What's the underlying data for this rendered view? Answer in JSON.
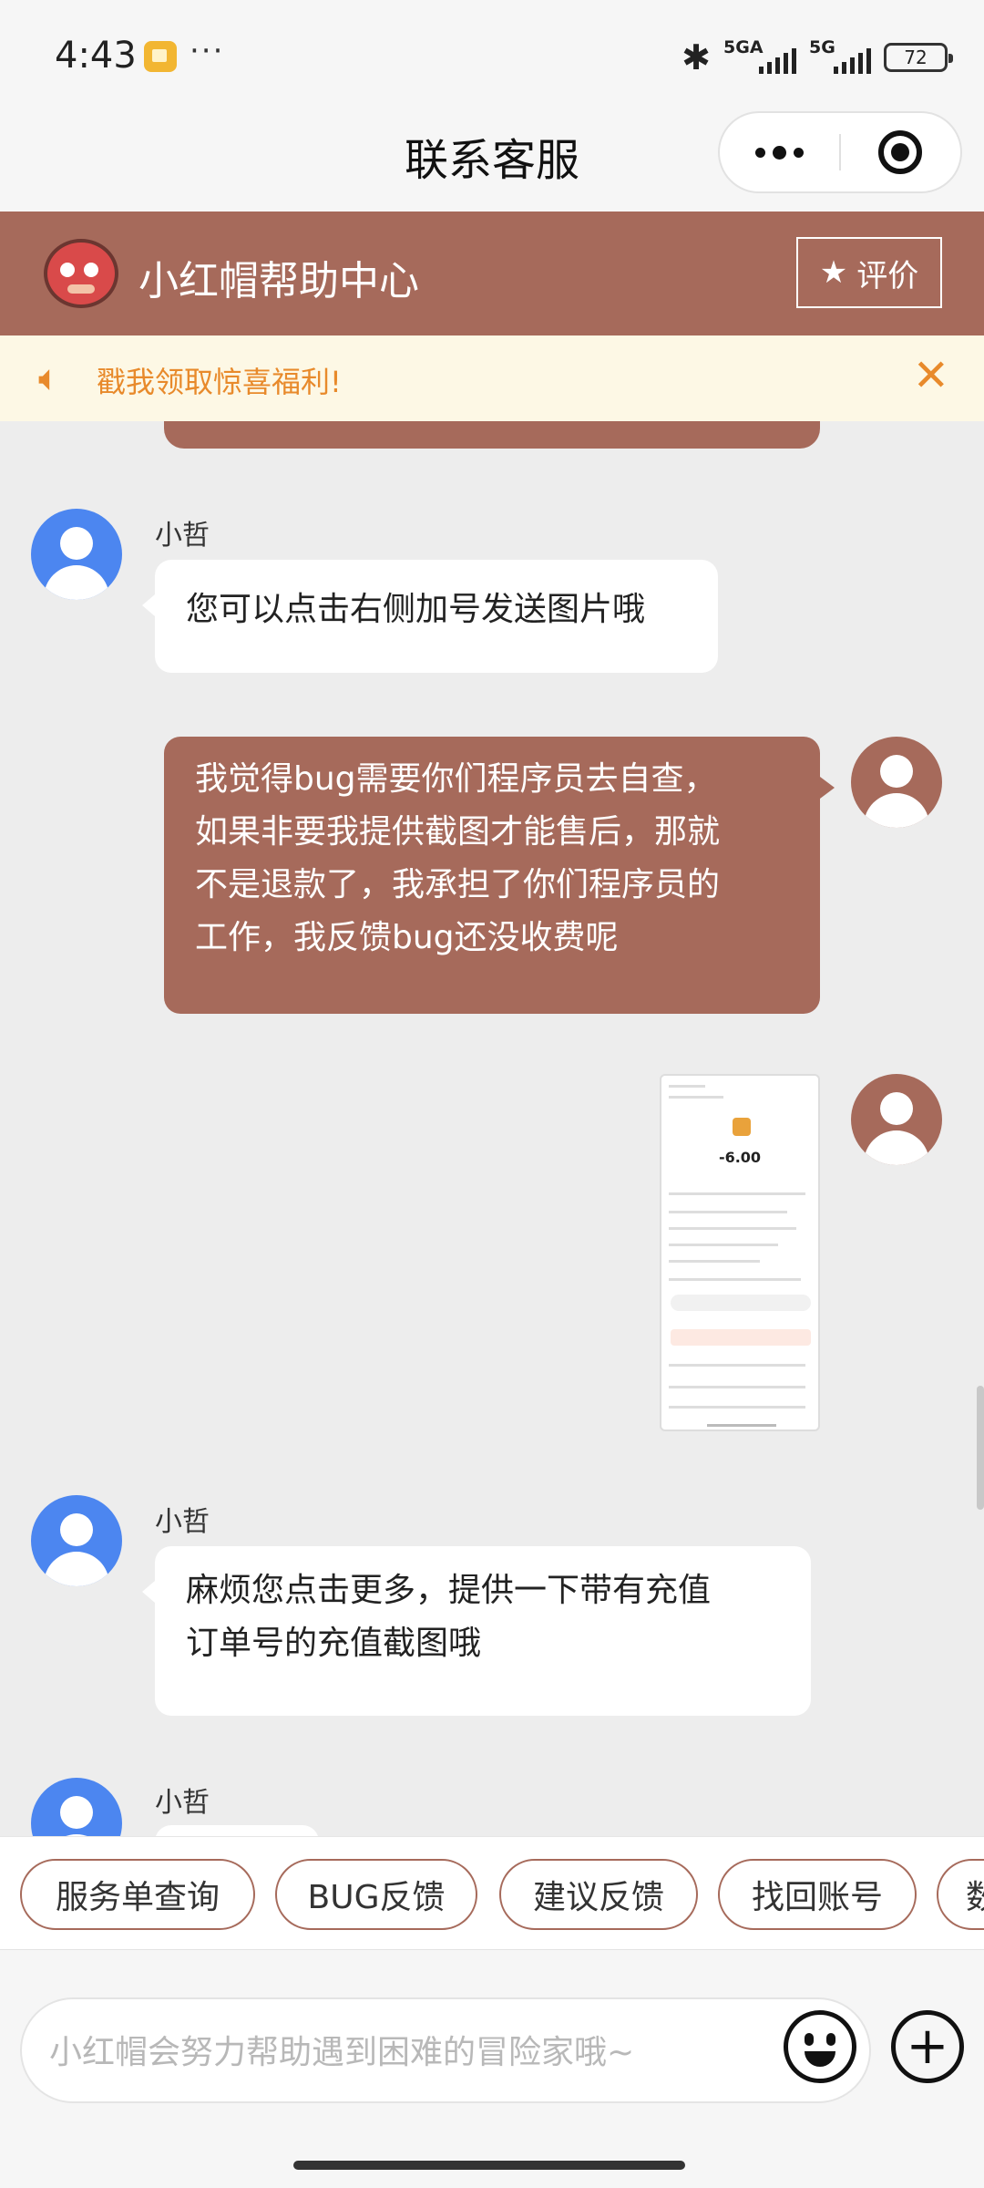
{
  "status": {
    "time": "4:43",
    "network1": "5GA",
    "network2": "5G",
    "battery": "72",
    "more_dots": "···"
  },
  "titlebar": {
    "title": "联系客服"
  },
  "brand": {
    "name": "小红帽帮助中心",
    "rate_label": "评价",
    "accent": "#a66a5b"
  },
  "notice": {
    "text": "戳我领取惊喜福利!"
  },
  "messages": [
    {
      "from": "agent",
      "sender": "小哲",
      "text": "您可以点击右侧加号发送图片哦"
    },
    {
      "from": "user",
      "lines": [
        "我觉得bug需要你们程序员去自查，",
        "如果非要我提供截图才能售后，那就",
        "不是退款了，我承担了你们程序员的",
        "工作，我反馈bug还没收费呢"
      ]
    },
    {
      "from": "user",
      "type": "image",
      "amount": "-6.00"
    },
    {
      "from": "agent",
      "sender": "小哲",
      "lines": [
        "麻烦您点击更多，提供一下带有充值",
        "订单号的充值截图哦"
      ]
    },
    {
      "from": "agent",
      "sender": "小哲",
      "text": ""
    }
  ],
  "chips": [
    "服务单查询",
    "BUG反馈",
    "建议反馈",
    "找回账号",
    "数"
  ],
  "input": {
    "placeholder": "小红帽会努力帮助遇到困难的冒险家哦~"
  },
  "icons": [
    "bluetooth-icon",
    "speaker-icon",
    "close-icon",
    "star-icon",
    "emoji-icon",
    "plus-icon",
    "more-icon",
    "target-icon"
  ]
}
